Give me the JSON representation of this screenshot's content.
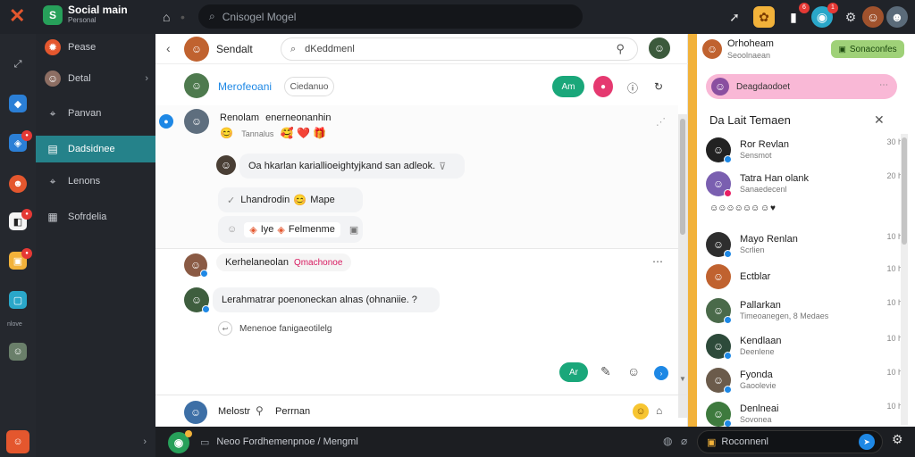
{
  "app": {
    "title": "Social main",
    "subtitle": "Personal"
  },
  "global_search": {
    "placeholder": "Cnisogel Mogel"
  },
  "top_badges": {
    "notifications": "6",
    "messages": "1"
  },
  "nav": {
    "items": [
      {
        "label": "Pease",
        "icon": "fire-icon"
      },
      {
        "label": "Detal",
        "icon": "avatar"
      },
      {
        "label": "Panvan",
        "icon": "tag-icon"
      },
      {
        "label": "Dadsidnee",
        "icon": "calendar-icon"
      },
      {
        "label": "Lenons",
        "icon": "tag-icon"
      },
      {
        "label": "Sofrdelia",
        "icon": "grid-icon"
      }
    ],
    "active_index": 3
  },
  "rail": {
    "caption": "nlove"
  },
  "chat": {
    "title": "Sendalt",
    "search_placeholder": "dKeddmenl",
    "group": {
      "name": "Merofeoani",
      "tag": "Ciedanuo",
      "action_label": "Am"
    },
    "messages": [
      {
        "author": "Renolam",
        "author_extra": "enerneonanhin",
        "time": "Tannalus",
        "emojis": "🥰 ❤️ 🎁"
      },
      {
        "text": "Oa hkarlan kariallioeightyjkand san adleok."
      },
      {
        "text": "Lhandrodin",
        "emoji": "😊",
        "extra": "Mape"
      },
      {
        "chip_text": "Iye",
        "chip_label": "Felmenme"
      },
      {
        "author": "Kerhelaneolan",
        "tag": "Qmachonoe"
      },
      {
        "text": "Lerahmatrar poenoneckan alnas (ohnaniie. ?"
      },
      {
        "text": "Menenoe fanigaeotilelg"
      }
    ],
    "send_label": "Ar",
    "composer": {
      "author": "Melostr",
      "text": "Perrnan"
    }
  },
  "right_panel": {
    "user_name": "Orhoheam",
    "user_status": "Seoolnaean",
    "action_label": "Sonaconfes",
    "banner_label": "Deagdaodoet",
    "section_title": "Da Lait Temaen",
    "friends": [
      {
        "name": "Ror Revlan",
        "sub": "Sensmot",
        "time": "30 h"
      },
      {
        "name": "Tatra Han olank",
        "sub": "Sanaedecenl",
        "time": "20 h"
      },
      {
        "name": "Mayo Renlan",
        "sub": "Scrlien",
        "time": "10 h"
      },
      {
        "name": "Ectblar",
        "sub": "",
        "time": "10 h"
      },
      {
        "name": "Pallarkan",
        "sub": "Timeoanegen, 8 Medaes",
        "time": "10 h"
      },
      {
        "name": "Kendlaan",
        "sub": "Deenlene",
        "time": "10 h"
      },
      {
        "name": "Fyonda",
        "sub": "Gaoolevie",
        "time": "10 h"
      },
      {
        "name": "Denlneai",
        "sub": "Sovonea",
        "time": "10 h"
      }
    ]
  },
  "bottom": {
    "input_text": "Neoo Fordhemenpnoe / Mengml",
    "right_text": "Roconnenl"
  },
  "colors": {
    "accent": "#25828a",
    "brand": "#27a05a",
    "strip": "#f2b23a",
    "send": "#1aa77a"
  }
}
